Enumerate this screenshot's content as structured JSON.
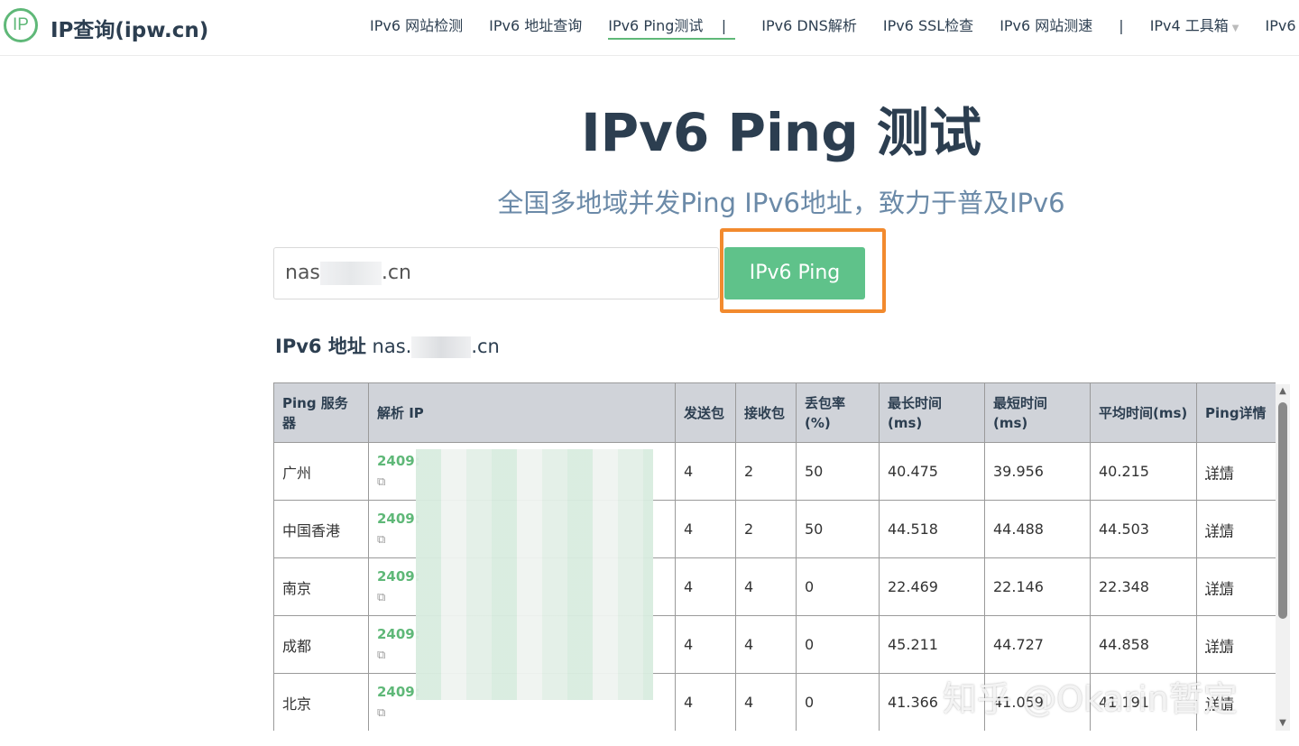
{
  "header": {
    "logo_icon_text": "IP",
    "logo_text": "IP查询(ipw.cn)",
    "nav": [
      {
        "label": "IPv6 网站检测"
      },
      {
        "label": "IPv6 地址查询"
      },
      {
        "label": "IPv6 Ping测试"
      },
      {
        "label": "IPv6 DNS解析"
      },
      {
        "label": "IPv6 SSL检查"
      },
      {
        "label": "IPv6 网站测速"
      },
      {
        "label": "IPv4 工具箱"
      },
      {
        "label": "IPv6"
      }
    ],
    "separator": "|"
  },
  "main": {
    "title": "IPv6 Ping 测试",
    "subtitle": "全国多地域并发Ping IPv6地址，致力于普及IPv6",
    "input_value_prefix": "nas",
    "input_value_suffix": ".cn",
    "button_label": "IPv6 Ping",
    "result_label": "IPv6 地址",
    "result_host_prefix": "nas.",
    "result_host_suffix": ".cn"
  },
  "table": {
    "headers": [
      "Ping 服务器",
      "解析 IP",
      "发送包",
      "接收包",
      "丢包率(%)",
      "最长时间(ms)",
      "最短时间(ms)",
      "平均时间(ms)",
      "Ping详情"
    ],
    "rows": [
      {
        "server": "广州",
        "ip": "2409:",
        "sent": "4",
        "received": "2",
        "loss": "50",
        "max": "40.475",
        "min": "39.956",
        "avg": "40.215",
        "detail": "详情"
      },
      {
        "server": "中国香港",
        "ip": "2409:",
        "sent": "4",
        "received": "2",
        "loss": "50",
        "max": "44.518",
        "min": "44.488",
        "avg": "44.503",
        "detail": "详情"
      },
      {
        "server": "南京",
        "ip": "2409:",
        "sent": "4",
        "received": "4",
        "loss": "0",
        "max": "22.469",
        "min": "22.146",
        "avg": "22.348",
        "detail": "详情"
      },
      {
        "server": "成都",
        "ip": "2409:",
        "sent": "4",
        "received": "4",
        "loss": "0",
        "max": "45.211",
        "min": "44.727",
        "avg": "44.858",
        "detail": "详情"
      },
      {
        "server": "北京",
        "ip": "2409:",
        "sent": "4",
        "received": "4",
        "loss": "0",
        "max": "41.366",
        "min": "41.059",
        "avg": "41.191",
        "detail": "详情"
      }
    ]
  },
  "watermark": "知乎 @Okarin暂定",
  "colors": {
    "accent": "#5fb878",
    "button": "#5fc28a",
    "highlight": "#f28a2e",
    "subtitle": "#6b8aa8"
  }
}
